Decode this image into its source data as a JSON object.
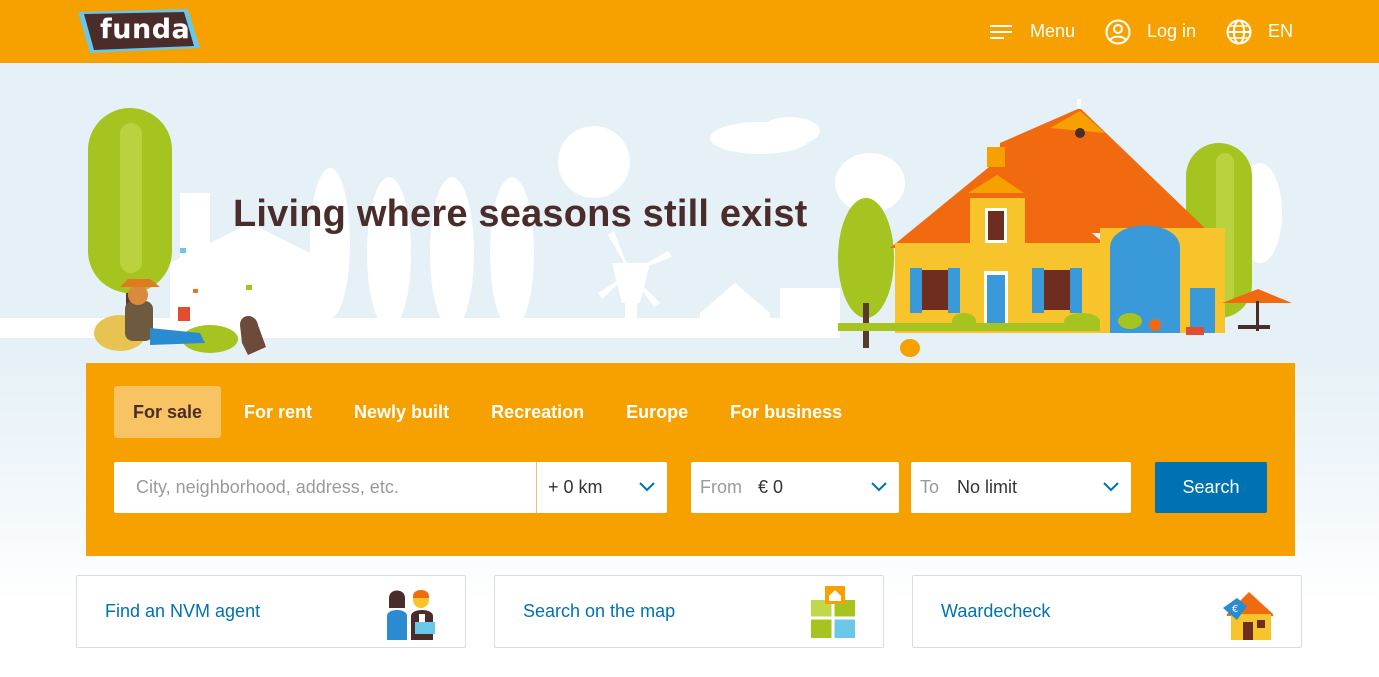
{
  "header": {
    "logo_text": "funda",
    "menu_label": "Menu",
    "login_label": "Log in",
    "language_label": "EN"
  },
  "hero": {
    "title": "Living where seasons still exist"
  },
  "search": {
    "tabs": [
      {
        "label": "For sale",
        "active": true
      },
      {
        "label": "For rent",
        "active": false
      },
      {
        "label": "Newly built",
        "active": false
      },
      {
        "label": "Recreation",
        "active": false
      },
      {
        "label": "Europe",
        "active": false
      },
      {
        "label": "For business",
        "active": false
      }
    ],
    "location_placeholder": "City, neighborhood, address, etc.",
    "radius_value": "+ 0 km",
    "price_from_prefix": "From",
    "price_from_value": "€ 0",
    "price_to_prefix": "To",
    "price_to_value": "No limit",
    "search_button": "Search"
  },
  "cards": [
    {
      "label": "Find an NVM agent",
      "icon": "agents-icon"
    },
    {
      "label": "Search on the map",
      "icon": "map-icon"
    },
    {
      "label": "Waardecheck",
      "icon": "house-value-icon"
    }
  ],
  "colors": {
    "brand_orange": "#f7a100",
    "active_tab": "#f8c463",
    "primary_blue": "#0071b3",
    "title_brown": "#4a2c2a",
    "sky": "#e6f1f7"
  }
}
